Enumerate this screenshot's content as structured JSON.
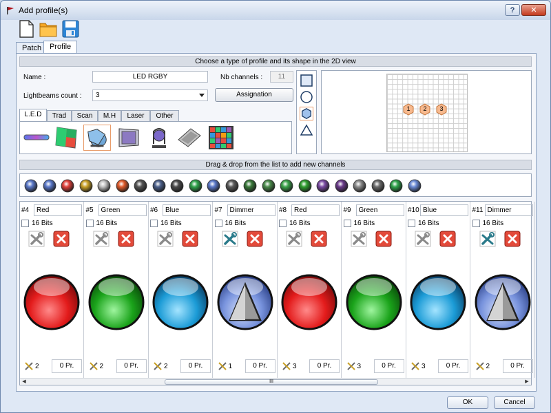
{
  "window": {
    "title": "Add profile(s)",
    "help_label": "?",
    "close_label": "✕"
  },
  "toolbar": {
    "icons": [
      "new-file-icon",
      "open-folder-icon",
      "save-icon"
    ]
  },
  "tabs": [
    {
      "label": "Patch",
      "active": false
    },
    {
      "label": "Profile",
      "active": true
    }
  ],
  "profile": {
    "section_title": "Choose a type of profile and its shape in the 2D view",
    "name_label": "Name :",
    "name_value": "LED RGBY",
    "nb_channels_label": "Nb channels :",
    "nb_channels_value": "11",
    "lightbeams_label": "Lightbeams count :",
    "lightbeams_value": "3",
    "assignation_label": "Assignation",
    "categories": [
      "L.E.D",
      "Trad",
      "Scan",
      "M.H",
      "Laser",
      "Other"
    ],
    "active_category": "L.E.D",
    "fixtures": [
      "led-bar-icon",
      "led-panel-icon",
      "par-can-icon",
      "flood-icon",
      "moving-head-icon",
      "led-matrix-icon",
      "color-grid-icon"
    ],
    "selected_fixture": 2,
    "shapes": [
      "square",
      "circle",
      "hexagon",
      "triangle"
    ],
    "selected_shape": "hexagon",
    "beams": [
      "1",
      "2",
      "3"
    ]
  },
  "channels_section": {
    "title": "Drag & drop from the list to add new channels",
    "palette": [
      "dimmer-icon",
      "shutter-icon",
      "color-wheel-icon",
      "rgb-icon",
      "gobo-icon",
      "prism-icon",
      "iris-icon",
      "focus-icon",
      "strobe-icon",
      "zoom-icon",
      "frost-icon",
      "pan-icon",
      "tilt-icon",
      "speed-icon",
      "macro-icon",
      "effect-icon",
      "fan-icon",
      "reset-icon",
      "lamp-icon",
      "control-icon",
      "function-icon",
      "unknown-icon"
    ]
  },
  "channels": [
    {
      "num": "#4",
      "name": "Red",
      "bits": "16 Bits",
      "count": "2",
      "pr": "0 Pr.",
      "kind": "red"
    },
    {
      "num": "#5",
      "name": "Green",
      "bits": "16 Bits",
      "count": "2",
      "pr": "0 Pr.",
      "kind": "green"
    },
    {
      "num": "#6",
      "name": "Blue",
      "bits": "16 Bits",
      "count": "2",
      "pr": "0 Pr.",
      "kind": "blue"
    },
    {
      "num": "#7",
      "name": "Dimmer",
      "bits": "16 Bits",
      "count": "1",
      "pr": "0 Pr.",
      "kind": "dimmer"
    },
    {
      "num": "#8",
      "name": "Red",
      "bits": "16 Bits",
      "count": "3",
      "pr": "0 Pr.",
      "kind": "red"
    },
    {
      "num": "#9",
      "name": "Green",
      "bits": "16 Bits",
      "count": "3",
      "pr": "0 Pr.",
      "kind": "green"
    },
    {
      "num": "#10",
      "name": "Blue",
      "bits": "16 Bits",
      "count": "3",
      "pr": "0 Pr.",
      "kind": "blue"
    },
    {
      "num": "#11",
      "name": "Dimmer",
      "bits": "16 Bits",
      "count": "2",
      "pr": "0 Pr.",
      "kind": "dimmer"
    }
  ],
  "scrollbar": {
    "thumb_label": "III"
  },
  "footer": {
    "ok_label": "OK",
    "cancel_label": "Cancel"
  },
  "colors": {
    "accent": "#e89b69",
    "red": "#e31b1b",
    "green": "#1aa31a",
    "blue": "#1b9bd6",
    "dimmer": "#4b6fd1"
  }
}
